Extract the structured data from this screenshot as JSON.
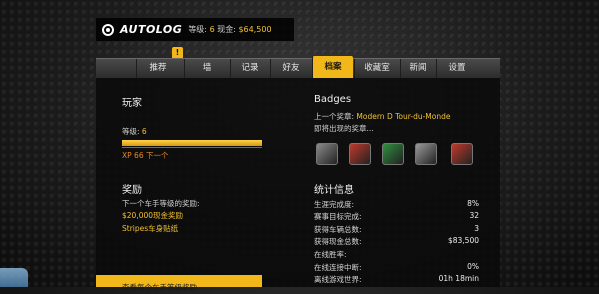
{
  "header": {
    "logo_text": "AUTOLOG",
    "level_label": "等级:",
    "level_value": "6",
    "cash_label": "现金:",
    "cash_value": "$64,500"
  },
  "notification_count": "!",
  "nav": {
    "left_key": "L",
    "right_key": "R"
  },
  "tabs": [
    {
      "label": "推荐"
    },
    {
      "label": "墙"
    },
    {
      "label": "记录"
    },
    {
      "label": "好友"
    },
    {
      "label": "档案"
    },
    {
      "label": "收藏室"
    },
    {
      "label": "新闻"
    },
    {
      "label": "设置"
    }
  ],
  "player": {
    "title": "玩家",
    "level_text": "等级:",
    "level_value": "6",
    "xp_text": "XP 66 下一个",
    "xp_progress": 1.0
  },
  "badges": {
    "title": "Badges",
    "last_badge_label": "上一个奖章:",
    "last_badge_value": "Modern D Tour-du-Monde",
    "upcoming_label": "即将出现的奖章...",
    "tile_colors": [
      "#8a8a8a",
      "#c0392b",
      "#2f8f3f",
      "#9a9a9a",
      "#c0392b"
    ]
  },
  "reward": {
    "title": "奖励",
    "next_label": "下一个车手等级的奖励:",
    "cash_reward": "$20,000现金奖励",
    "livery_reward": "Stripes车身贴纸"
  },
  "stats": {
    "title": "统计信息",
    "rows": [
      {
        "label": "生涯完成度:",
        "value": "8%"
      },
      {
        "label": "赛事目标完成:",
        "value": "32"
      },
      {
        "label": "获得车辆总数:",
        "value": "3"
      },
      {
        "label": "获得现金总数:",
        "value": "$83,500"
      },
      {
        "label": "在线胜率:",
        "value": ""
      },
      {
        "label": "在线连接中断:",
        "value": "0%"
      },
      {
        "label": "离线游戏世界:",
        "value": "01h  18min"
      }
    ]
  },
  "bottom_strip": {
    "label": "查看每个车手等级奖励"
  }
}
